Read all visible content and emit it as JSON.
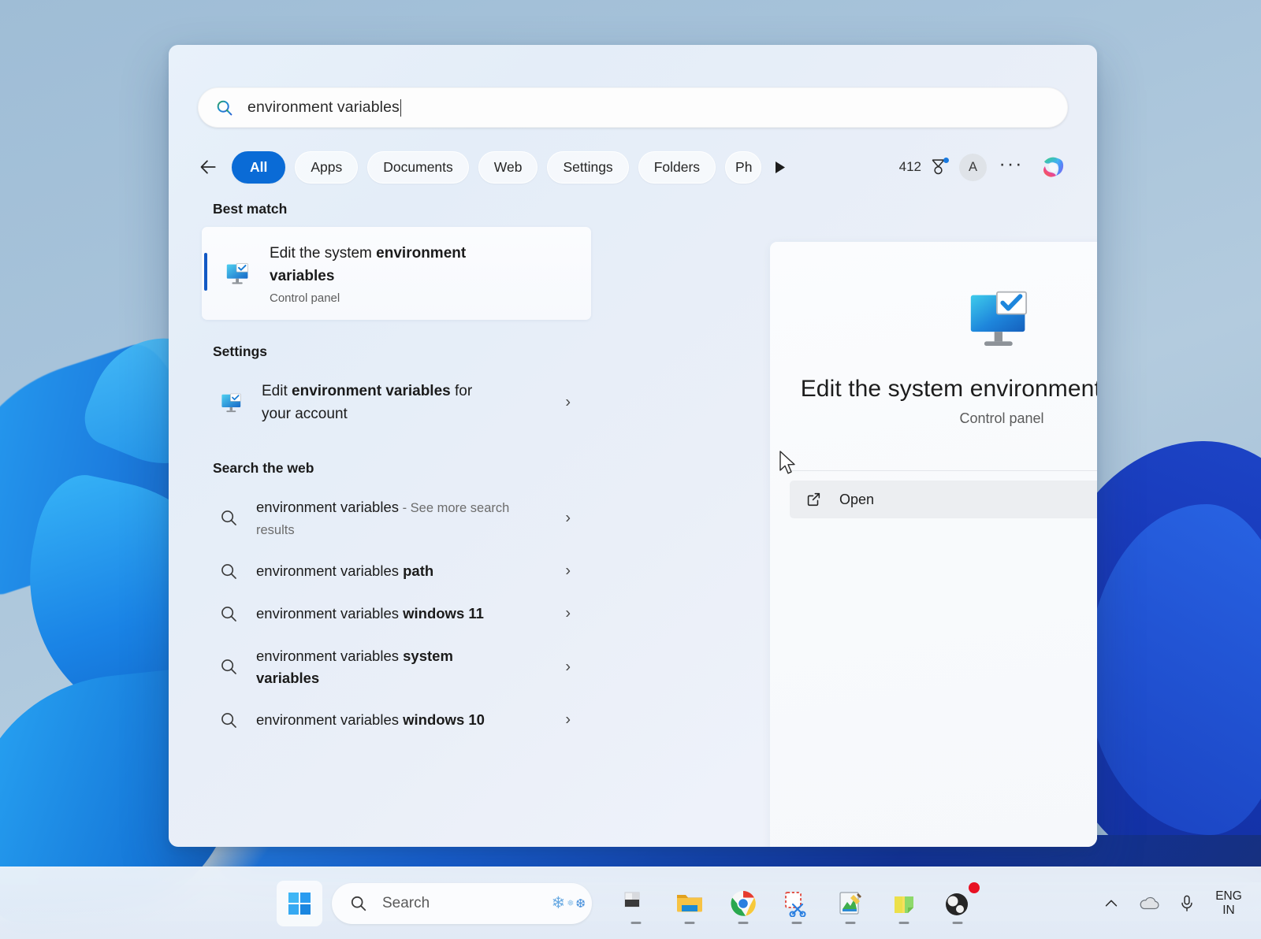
{
  "search": {
    "value": "environment variables",
    "icon": "search-icon"
  },
  "tabs": {
    "back_icon": "back-arrow-icon",
    "items": [
      {
        "label": "All",
        "active": true
      },
      {
        "label": "Apps",
        "active": false
      },
      {
        "label": "Documents",
        "active": false
      },
      {
        "label": "Web",
        "active": false
      },
      {
        "label": "Settings",
        "active": false
      },
      {
        "label": "Folders",
        "active": false
      },
      {
        "label": "Ph",
        "active": false,
        "clipped": true
      }
    ],
    "scroll_next_icon": "scroll-right-arrow-icon",
    "rewards_count": "412",
    "rewards_icon": "rewards-medal-icon",
    "avatar_initial": "A",
    "more_label": "···",
    "copilot_icon": "copilot-icon"
  },
  "results": {
    "best_match_heading": "Best match",
    "best_match": {
      "title_plain": "Edit the system ",
      "title_bold": "environment variables",
      "subtitle": "Control panel",
      "icon": "system-properties-icon"
    },
    "settings_heading": "Settings",
    "settings_items": [
      {
        "prefix": "Edit ",
        "bold": "environment variables",
        "suffix": " for your account",
        "icon": "system-properties-icon",
        "chevron": "›"
      }
    ],
    "web_heading": "Search the web",
    "web_items": [
      {
        "prefix": "environment variables",
        "bold": "",
        "suffix": " - See more search results",
        "suffix_muted": true,
        "icon": "search-icon",
        "chevron": "›"
      },
      {
        "prefix": "environment variables ",
        "bold": "path",
        "suffix": "",
        "icon": "search-icon",
        "chevron": "›"
      },
      {
        "prefix": "environment variables ",
        "bold": "windows 11",
        "suffix": "",
        "icon": "search-icon",
        "chevron": "›"
      },
      {
        "prefix": "environment variables ",
        "bold": "system variables",
        "suffix": "",
        "icon": "search-icon",
        "chevron": "›"
      },
      {
        "prefix": "environment variables ",
        "bold": "windows 10",
        "suffix": "",
        "icon": "search-icon",
        "chevron": "›"
      }
    ]
  },
  "preview": {
    "title": "Edit the system environment variables",
    "subtitle": "Control panel",
    "open_label": "Open",
    "open_icon": "external-link-icon",
    "app_icon": "system-properties-icon"
  },
  "taskbar": {
    "start_icon": "windows-start-icon",
    "search_placeholder": "Search",
    "search_icon": "search-icon",
    "decoration": "snowflake-decoration",
    "apps": [
      {
        "name": "task-view",
        "icon": "task-view-icon"
      },
      {
        "name": "file-explorer",
        "icon": "file-explorer-icon"
      },
      {
        "name": "google-chrome",
        "icon": "chrome-icon"
      },
      {
        "name": "snipping-tool",
        "icon": "snipping-tool-icon"
      },
      {
        "name": "paint",
        "icon": "paint-icon"
      },
      {
        "name": "sticky-notes",
        "icon": "sticky-notes-icon"
      },
      {
        "name": "obs-studio",
        "icon": "obs-icon",
        "badge": true
      }
    ],
    "tray": {
      "overflow_icon": "chevron-up-icon",
      "onedrive_icon": "onedrive-cloud-icon",
      "microphone_icon": "microphone-icon",
      "language_line1": "ENG",
      "language_line2": "IN"
    }
  },
  "colors": {
    "accent": "#0a6bd6",
    "selection_bar": "#1259c4",
    "panel_bg": "#e8f1fa",
    "taskbar_bg": "#ecf2f9"
  }
}
